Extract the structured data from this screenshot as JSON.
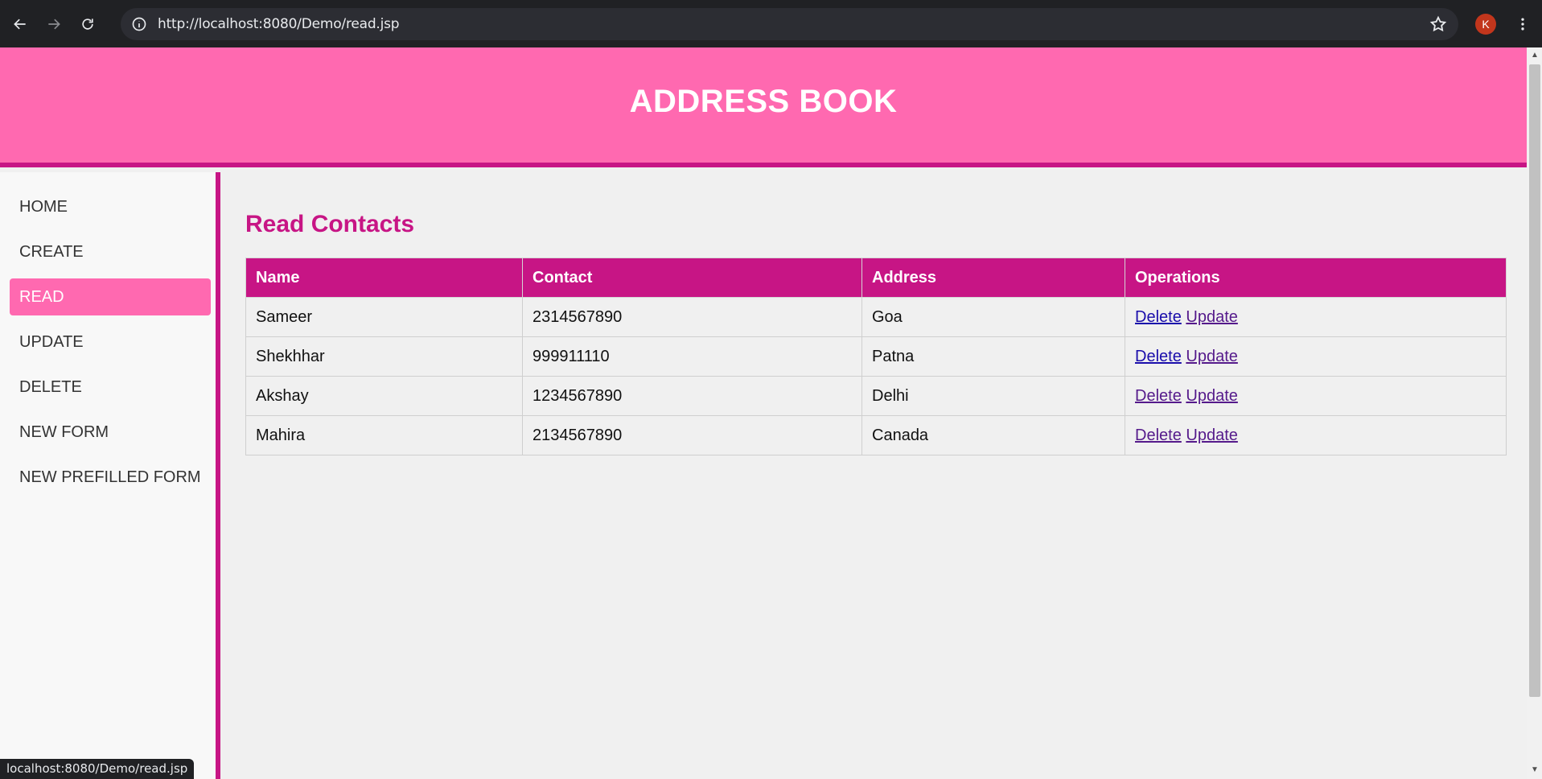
{
  "browser": {
    "url": "http://localhost:8080/Demo/read.jsp",
    "avatar_letter": "K",
    "status_url": "localhost:8080/Demo/read.jsp"
  },
  "header": {
    "title": "ADDRESS BOOK"
  },
  "sidebar": {
    "items": [
      {
        "label": "HOME",
        "active": false
      },
      {
        "label": "CREATE",
        "active": false
      },
      {
        "label": "READ",
        "active": true
      },
      {
        "label": "UPDATE",
        "active": false
      },
      {
        "label": "DELETE",
        "active": false
      },
      {
        "label": "NEW FORM",
        "active": false
      },
      {
        "label": "NEW PREFILLED FORM",
        "active": false
      }
    ]
  },
  "main": {
    "title": "Read Contacts",
    "table": {
      "columns": [
        "Name",
        "Contact",
        "Address",
        "Operations"
      ],
      "rows": [
        {
          "name": "Sameer",
          "contact": "2314567890",
          "address": "Goa",
          "delete": "Delete",
          "update": "Update"
        },
        {
          "name": "Shekhhar",
          "contact": "999911110",
          "address": "Patna",
          "delete": "Delete",
          "update": "Update"
        },
        {
          "name": "Akshay",
          "contact": "1234567890",
          "address": "Delhi",
          "delete": "Delete",
          "update": "Update"
        },
        {
          "name": "Mahira",
          "contact": "2134567890",
          "address": "Canada",
          "delete": "Delete",
          "update": "Update"
        }
      ]
    }
  },
  "colors": {
    "header_bg": "#ff69b0",
    "accent": "#c71585",
    "active_nav": "#ff69b0"
  }
}
